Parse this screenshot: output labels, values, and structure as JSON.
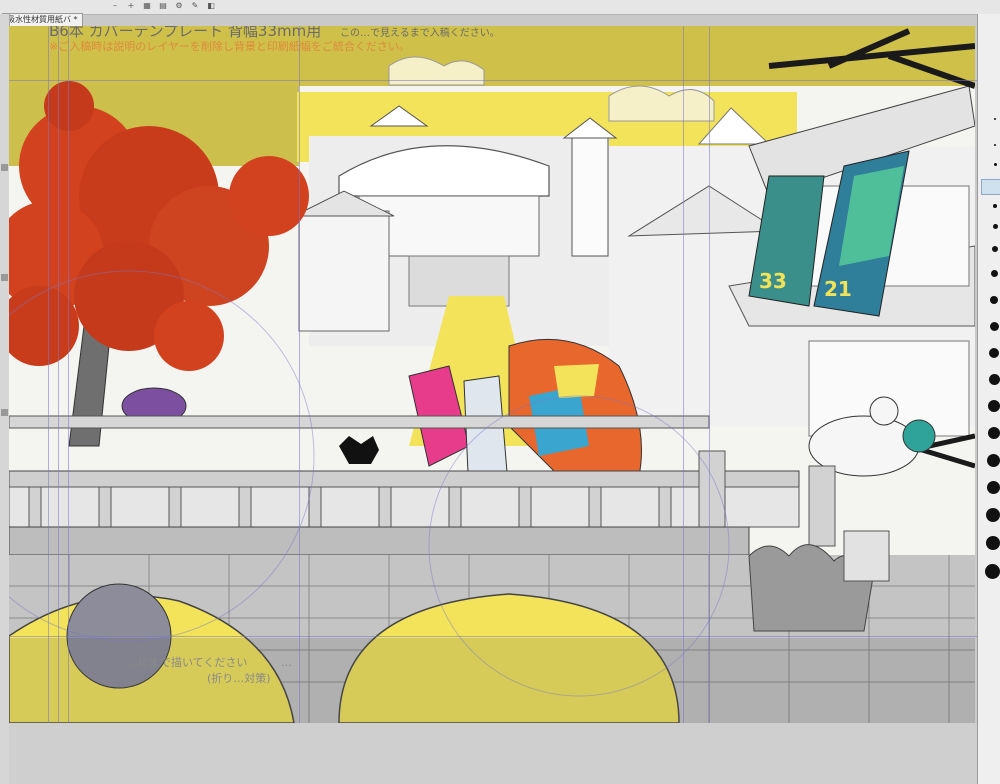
{
  "document_tab": {
    "label": "吸水性材質用紙バ *"
  },
  "template_note": {
    "line1": "B6本  カバーテンプレート  背幅33mm用",
    "line1_tail": "この…で見えるまで入稿ください。",
    "line2": "※ご入稿時は説明のレイヤーを削除し背景と印刷紙幅をご統合ください。"
  },
  "bleed_note": {
    "line1": "…にまで描いてください",
    "line1_tail": "…",
    "line2": "(折り…対策)"
  },
  "banner_left": {
    "label": "33"
  },
  "banner_right": {
    "label": "21"
  },
  "colors": {
    "accent_yellow": "#f2e35a",
    "maple_red": "#d2421f",
    "note_orange": "#e08a3a",
    "guide_purple": "#7a76c8"
  }
}
